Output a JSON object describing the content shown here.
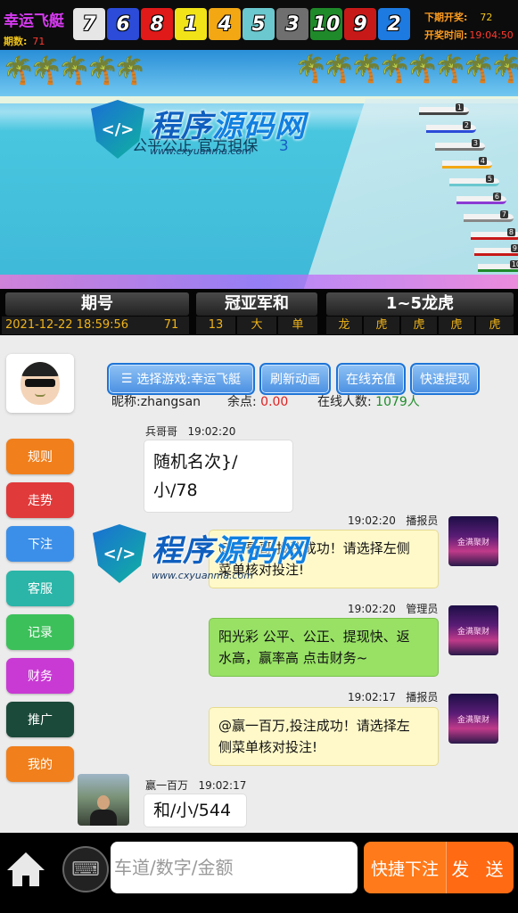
{
  "header": {
    "title": "幸运飞艇",
    "period_label": "期数:",
    "period_value": "71",
    "draw_numbers": [
      {
        "n": "7",
        "color": "#e6e6e6"
      },
      {
        "n": "6",
        "color": "#2b4bd8"
      },
      {
        "n": "8",
        "color": "#e01919"
      },
      {
        "n": "1",
        "color": "#f2e318"
      },
      {
        "n": "4",
        "color": "#f2a713"
      },
      {
        "n": "5",
        "color": "#6bc8cf"
      },
      {
        "n": "3",
        "color": "#6f6f6f"
      },
      {
        "n": "10",
        "color": "#1f8a2a"
      },
      {
        "n": "9",
        "color": "#c81919"
      },
      {
        "n": "2",
        "color": "#1d7ae0"
      }
    ],
    "next_label": "下期开奖:",
    "next_value": "72",
    "time_label": "开奖时间:",
    "time_value": "19:04:50"
  },
  "scene": {
    "banner_text": "公平公正    官方担保",
    "banner_digit": "3",
    "watermark_main_a": "程序",
    "watermark_main_b": "源码网",
    "watermark_url": "www.cxyuanma.com",
    "boats": [
      "1",
      "2",
      "3",
      "4",
      "5",
      "6",
      "7",
      "8",
      "9",
      "10"
    ]
  },
  "stats": {
    "headers": [
      "期号",
      "冠亚军和",
      "1~5龙虎"
    ],
    "datetime": "2021-12-22 18:59:56",
    "period": "71",
    "sum": "13",
    "size": "大",
    "parity": "单",
    "dragon_tiger": [
      "龙",
      "虎",
      "虎",
      "虎",
      "虎"
    ]
  },
  "user": {
    "buttons": [
      "选择游戏:幸运飞艇",
      "刷新动画",
      "在线充值",
      "快速提现"
    ],
    "nickname_label": "昵称:zhangsan",
    "balance_label": "余点:",
    "balance_value": "0.00",
    "online_label": "在线人数:",
    "online_value": "1079人"
  },
  "sidebar": [
    {
      "label": "规则",
      "color": "#f07f1c"
    },
    {
      "label": "走势",
      "color": "#e03a3a"
    },
    {
      "label": "下注",
      "color": "#3c8fe8"
    },
    {
      "label": "客服",
      "color": "#2ab5a8"
    },
    {
      "label": "记录",
      "color": "#3cc05a"
    },
    {
      "label": "财务",
      "color": "#c93ad4"
    },
    {
      "label": "推广",
      "color": "#1c4a3a"
    },
    {
      "label": "我的",
      "color": "#f07f1c"
    }
  ],
  "chat": [
    {
      "name": "兵哥哥",
      "time": "19:02:20",
      "text_1": "随机名次}/",
      "text_2": "小/78"
    },
    {
      "name": "播报员",
      "time": "19:02:20",
      "text_1": "@兵哥哥,投注成功！请选择左侧",
      "text_2": "菜单核对投注!"
    },
    {
      "name": "管理员",
      "time": "19:02:20",
      "text_1": "阳光彩 公平、公正、提现快、返",
      "text_2": "水高，赢率高 点击财务~"
    },
    {
      "name": "播报员",
      "time": "19:02:17",
      "text_1": "@赢一百万,投注成功！请选择左",
      "text_2": "侧菜单核对投注!"
    },
    {
      "name": "赢一百万",
      "time": "19:02:17",
      "text_1": "和/小/544"
    }
  ],
  "bot_avatar_text": "金满聚财",
  "bottom": {
    "placeholder": "车道/数字/金额",
    "quick_label": "快捷下注",
    "send_label": "发 送",
    "keyboard_glyph": "⌨"
  }
}
